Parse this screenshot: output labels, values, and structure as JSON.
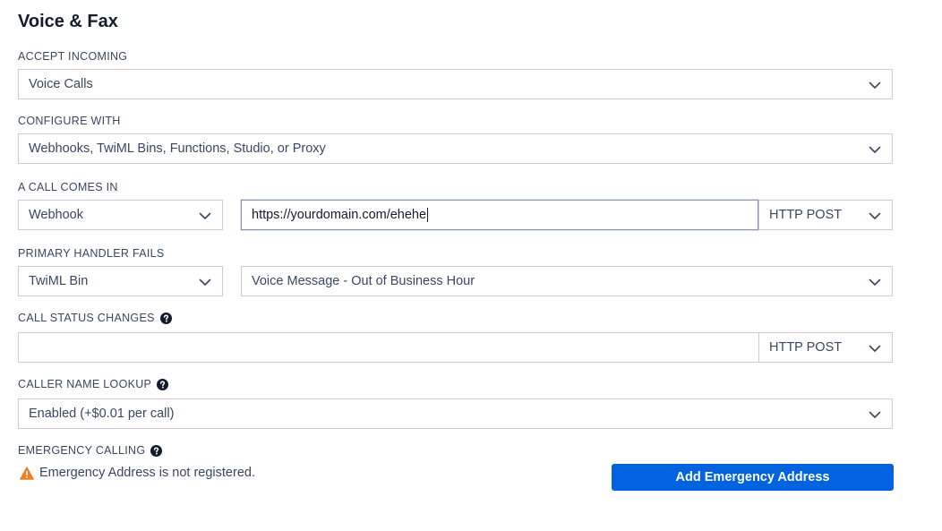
{
  "section": {
    "title": "Voice & Fax"
  },
  "accept_incoming": {
    "label": "ACCEPT INCOMING",
    "value": "Voice Calls"
  },
  "configure_with": {
    "label": "CONFIGURE WITH",
    "value": "Webhooks, TwiML Bins, Functions, Studio, or Proxy"
  },
  "call_comes_in": {
    "label": "A CALL COMES IN",
    "handler_type": "Webhook",
    "url": "https://yourdomain.com/ehehe",
    "method": "HTTP POST"
  },
  "primary_handler_fails": {
    "label": "PRIMARY HANDLER FAILS",
    "handler_type": "TwiML Bin",
    "bin": "Voice Message - Out of Business Hour"
  },
  "call_status_changes": {
    "label": "CALL STATUS CHANGES",
    "url": "",
    "method": "HTTP POST"
  },
  "caller_name_lookup": {
    "label": "CALLER NAME LOOKUP",
    "value": "Enabled (+$0.01 per call)"
  },
  "emergency_calling": {
    "label": "EMERGENCY CALLING",
    "warning": "Emergency Address is not registered.",
    "button_label": "Add Emergency Address"
  },
  "colors": {
    "accent": "#0263e0",
    "warning": "#f47c22",
    "text": "#121c2d",
    "border": "#cacdd8"
  },
  "icons": {
    "dropdown": "chevron-down-icon",
    "help": "help-icon",
    "warning": "warning-icon"
  }
}
